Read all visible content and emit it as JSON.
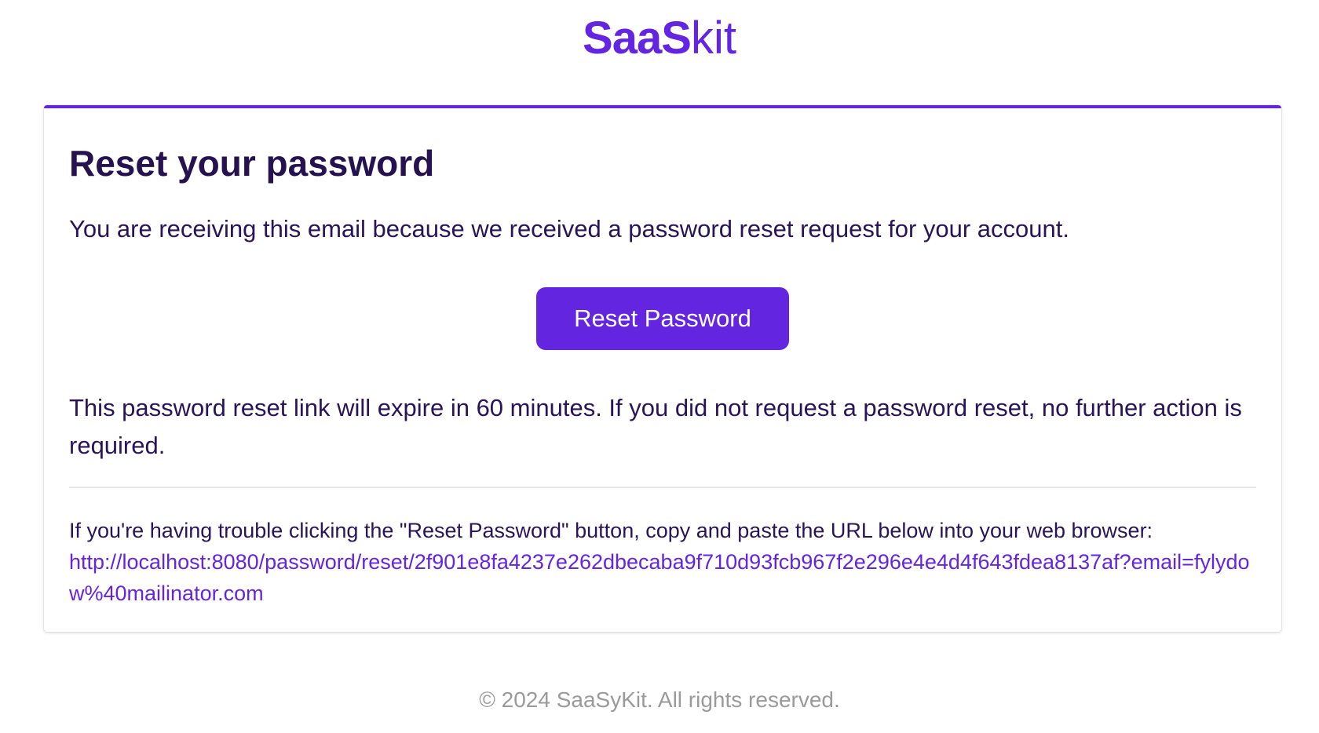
{
  "header": {
    "logo_bold": "SaaS",
    "logo_light": "kit"
  },
  "email": {
    "title": "Reset your password",
    "intro": "You are receiving this email because we received a password reset request for your account.",
    "button_label": "Reset Password",
    "expire_text": "This password reset link will expire in 60 minutes. If you did not request a password reset, no further action is required.",
    "trouble_text": "If you're having trouble clicking the \"Reset Password\" button, copy and paste the URL below into your web browser:",
    "reset_url": "http://localhost:8080/password/reset/2f901e8fa4237e262dbecaba9f710d93fcb967f2e296e4e4d4f643fdea8137af?email=fylydow%40mailinator.com"
  },
  "footer": {
    "copyright": "© 2024 SaaSyKit. All rights reserved."
  },
  "colors": {
    "accent": "#6425e0",
    "heading": "#261250",
    "text": "#2a1458",
    "muted": "#9a9a9a",
    "divider": "#e6e6ea"
  }
}
